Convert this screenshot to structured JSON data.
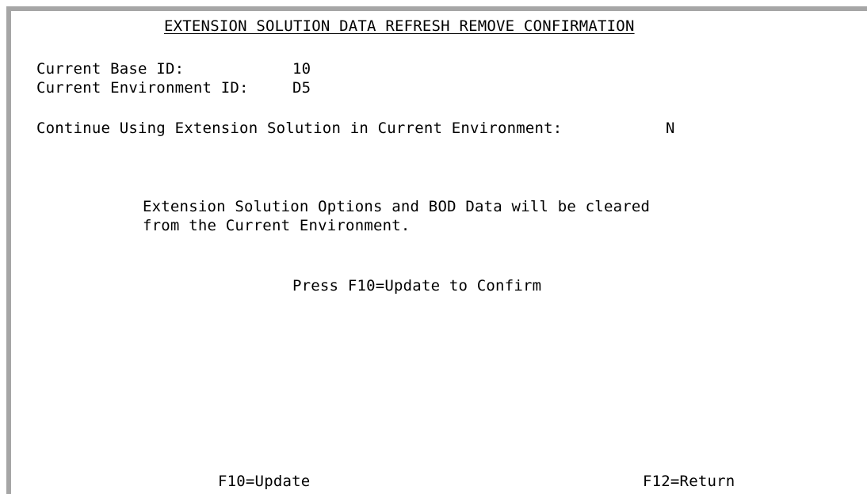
{
  "screen": {
    "title": "EXTENSION SOLUTION DATA REFRESH REMOVE CONFIRMATION",
    "fields": {
      "base_id_label": "Current Base ID:",
      "base_id_value": "10",
      "env_id_label": "Current Environment ID:",
      "env_id_value": "D5",
      "continue_label": "Continue Using Extension Solution in Current Environment:",
      "continue_value": "N"
    },
    "message": {
      "line1": "Extension Solution Options and BOD Data will be cleared",
      "line2": "from the Current Environment."
    },
    "prompt": "Press F10=Update to Confirm",
    "function_keys": {
      "update": "F10=Update",
      "return": "F12=Return"
    }
  }
}
